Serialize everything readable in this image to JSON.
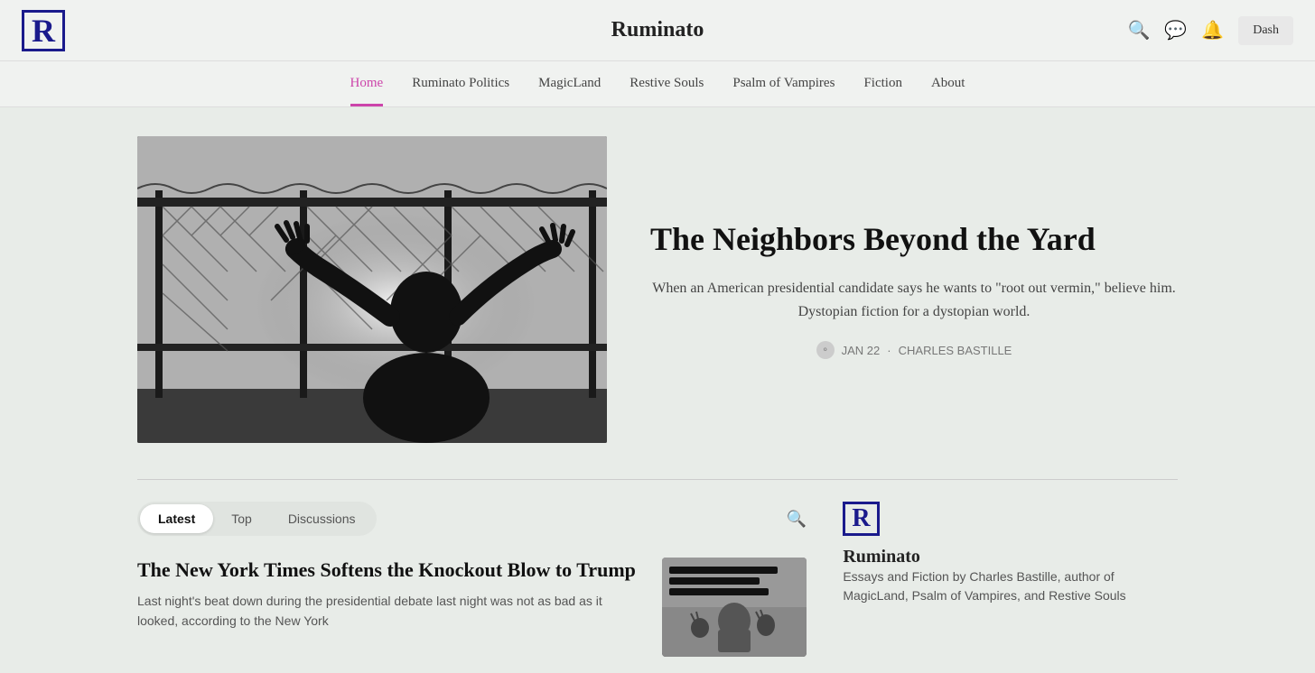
{
  "header": {
    "logo_letter": "R",
    "title": "Ruminato",
    "dash_button": "Dash"
  },
  "nav": {
    "items": [
      {
        "label": "Home",
        "active": true
      },
      {
        "label": "Ruminato Politics",
        "active": false
      },
      {
        "label": "MagicLand",
        "active": false
      },
      {
        "label": "Restive Souls",
        "active": false
      },
      {
        "label": "Psalm of Vampires",
        "active": false
      },
      {
        "label": "Fiction",
        "active": false
      },
      {
        "label": "About",
        "active": false
      }
    ]
  },
  "hero": {
    "title": "The Neighbors Beyond the Yard",
    "subtitle": "When an American presidential candidate says he wants to \"root out vermin,\" believe him. Dystopian fiction for a dystopian world.",
    "meta_date": "JAN 22",
    "meta_separator": "·",
    "meta_author": "CHARLES BASTILLE"
  },
  "tabs": {
    "items": [
      {
        "label": "Latest",
        "active": true
      },
      {
        "label": "Top",
        "active": false
      },
      {
        "label": "Discussions",
        "active": false
      }
    ]
  },
  "post": {
    "title": "The New York Times Softens the Knockout Blow to Trump",
    "excerpt": "Last night's beat down during the presidential debate last night was not as bad as it looked, according to the New York"
  },
  "sidebar": {
    "logo_letter": "R",
    "pub_name": "Ruminato",
    "description": "Essays and Fiction by Charles Bastille, author of MagicLand, Psalm of Vampires, and Restive Souls"
  }
}
